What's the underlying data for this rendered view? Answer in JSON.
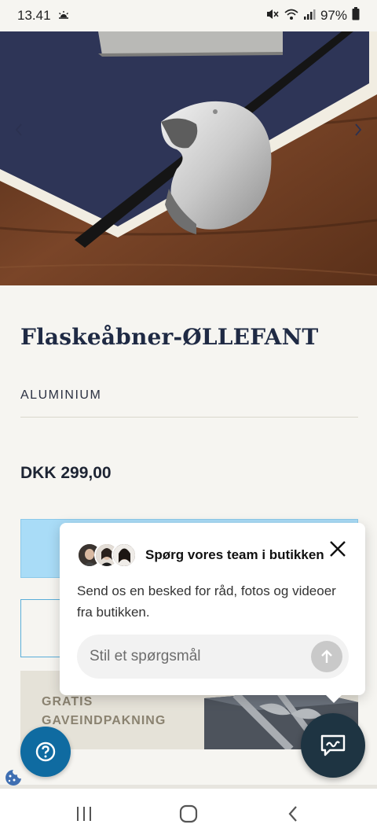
{
  "status_bar": {
    "time": "13.41",
    "battery": "97%"
  },
  "product": {
    "title": "Flaskeåbner-ØLLEFANT",
    "variant": "ALUMINIUM",
    "price": "DKK 299,00"
  },
  "gift_banner": {
    "line1": "GRATIS",
    "line2": "GAVEINDPAKNING"
  },
  "chat": {
    "title": "Spørg vores team i butikken",
    "description": "Send os en besked for råd, fotos og videoer fra butikken.",
    "input_placeholder": "Stil et spørgsmål"
  },
  "icons": {
    "status_weather": "sun-cloud-icon",
    "status_mute": "mute-icon",
    "status_wifi": "wifi-icon",
    "status_signal": "signal-icon",
    "status_battery": "battery-icon",
    "carousel_prev": "chevron-left-icon",
    "carousel_next": "chevron-right-icon",
    "chat_close": "close-icon",
    "send": "arrow-up-icon",
    "help": "question-icon",
    "chat_fab": "chat-icon",
    "cookie": "cookie-icon",
    "nav_recent": "recent-apps-icon",
    "nav_home": "home-icon",
    "nav_back": "back-icon"
  },
  "colors": {
    "background": "#f6f5f1",
    "primary_button": "#a9dcf7",
    "help_button": "#0f6ba1",
    "chat_fab": "#1e3442",
    "title_text": "#1f2a44"
  }
}
